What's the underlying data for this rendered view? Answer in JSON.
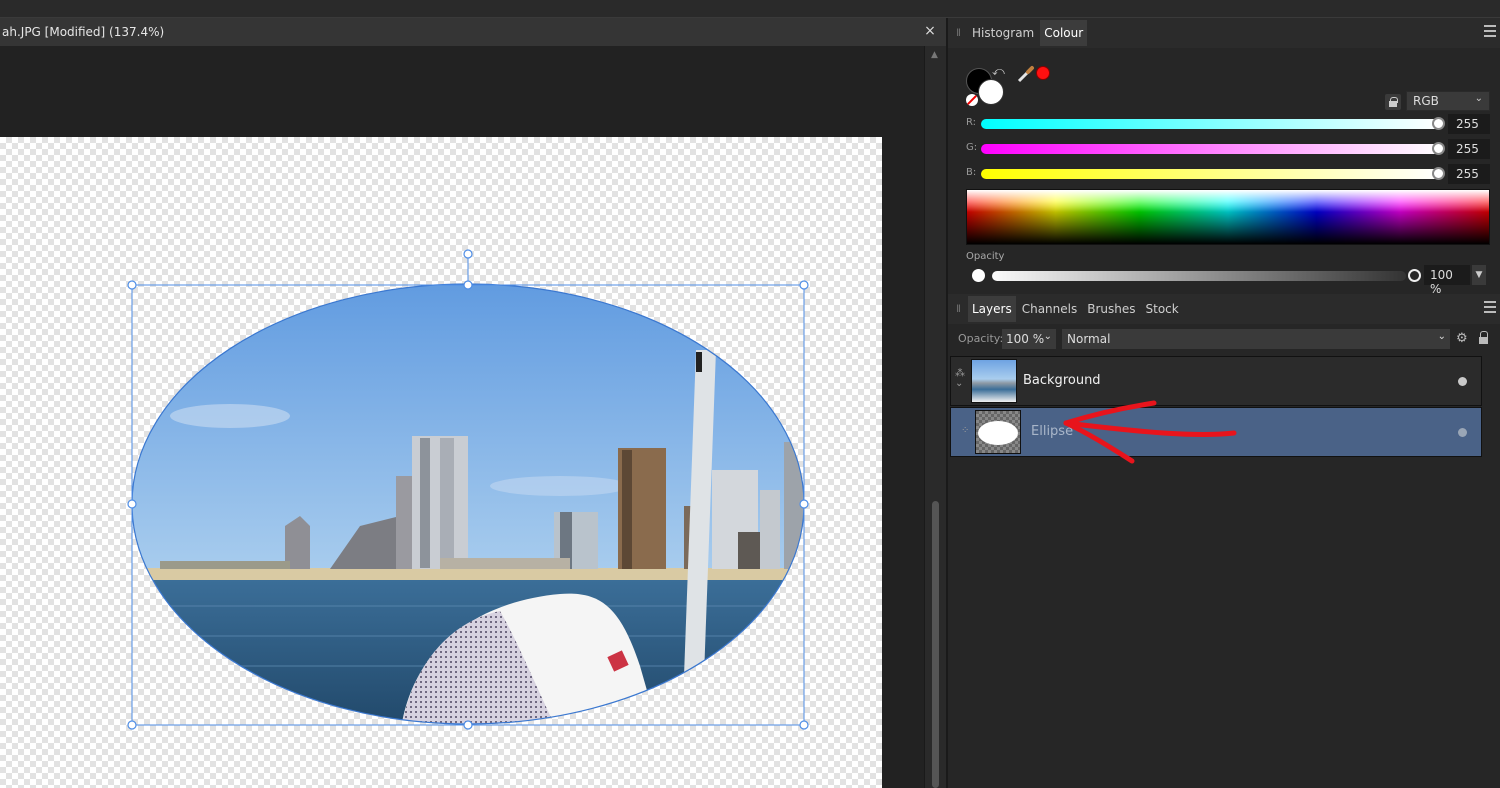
{
  "document": {
    "title": "ah.JPG [Modified] (137.4%)",
    "close_glyph": "×"
  },
  "colour_panel": {
    "tabs": [
      {
        "label": "Histogram",
        "active": false
      },
      {
        "label": "Colour",
        "active": true
      }
    ],
    "primary_colour": "#000000",
    "secondary_colour": "#ffffff",
    "picker_colour": "#ff1010",
    "colour_model": "RGB",
    "sliders": [
      {
        "label": "R:",
        "value": "255",
        "color": "#00ffff"
      },
      {
        "label": "G:",
        "value": "255",
        "color": "#ff00ff"
      },
      {
        "label": "B:",
        "value": "255",
        "color": "#ffff00"
      }
    ],
    "opacity_label": "Opacity",
    "opacity_value": "100 %"
  },
  "layers_panel": {
    "tabs": [
      {
        "label": "Layers",
        "active": true
      },
      {
        "label": "Channels",
        "active": false
      },
      {
        "label": "Brushes",
        "active": false
      },
      {
        "label": "Stock",
        "active": false
      }
    ],
    "opacity_label": "Opacity:",
    "opacity_value": "100 %",
    "blend_mode": "Normal",
    "layers": [
      {
        "name": "Background",
        "selected": false,
        "visible": true
      },
      {
        "name": "Ellipse",
        "selected": true,
        "visible": true
      }
    ]
  },
  "annotation": {
    "arrow_color": "#e8141c"
  }
}
